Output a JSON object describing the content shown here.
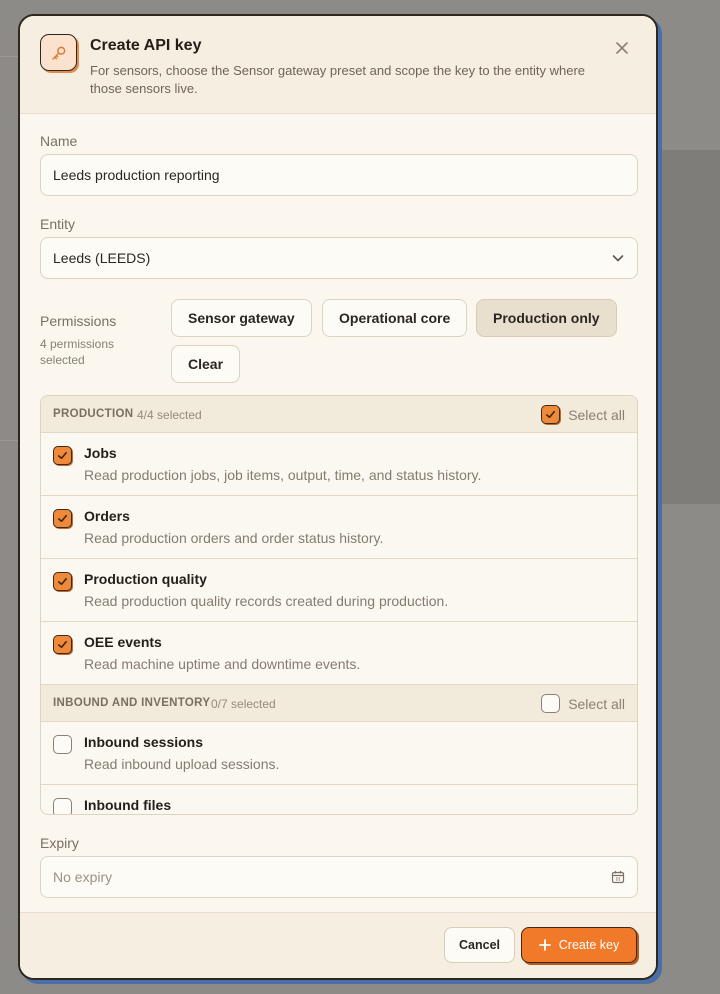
{
  "dialog": {
    "title": "Create API key",
    "subtitle": "For sensors, choose the Sensor gateway preset and scope the key to the entity where those sensors live.",
    "close_icon": "close-icon",
    "header_icon": "key-icon"
  },
  "name_field": {
    "label": "Name",
    "value": "Leeds production reporting"
  },
  "entity_field": {
    "label": "Entity",
    "value": "Leeds (LEEDS)"
  },
  "permissions": {
    "label": "Permissions",
    "count": "4 permissions selected",
    "presets": [
      {
        "label": "Sensor gateway"
      },
      {
        "label": "Operational core"
      },
      {
        "label": "Production only"
      },
      {
        "label": "Clear"
      }
    ],
    "active_preset": "Production only",
    "groups": [
      {
        "name": "PRODUCTION",
        "count": "4/4 selected",
        "select_all": "Select all",
        "all_checked": true,
        "items": [
          {
            "name": "Jobs",
            "desc": "Read production jobs, job items, output, time, and status history.",
            "checked": true
          },
          {
            "name": "Orders",
            "desc": "Read production orders and order status history.",
            "checked": true
          },
          {
            "name": "Production quality",
            "desc": "Read production quality records created during production.",
            "checked": true
          },
          {
            "name": "OEE events",
            "desc": "Read machine uptime and downtime events.",
            "checked": true
          }
        ]
      },
      {
        "name": "INBOUND AND INVENTORY",
        "count": "0/7 selected",
        "select_all": "Select all",
        "all_checked": false,
        "items": [
          {
            "name": "Inbound sessions",
            "desc": "Read inbound upload sessions.",
            "checked": false
          },
          {
            "name": "Inbound files",
            "desc": "",
            "checked": false
          }
        ]
      }
    ]
  },
  "expiry_field": {
    "label": "Expiry",
    "placeholder": "No expiry"
  },
  "footer": {
    "cancel_label": "Cancel",
    "create_label": "Create key"
  },
  "colors": {
    "accent": "#f07a2a",
    "surface": "#fbf7ef",
    "border": "#2e2720"
  }
}
